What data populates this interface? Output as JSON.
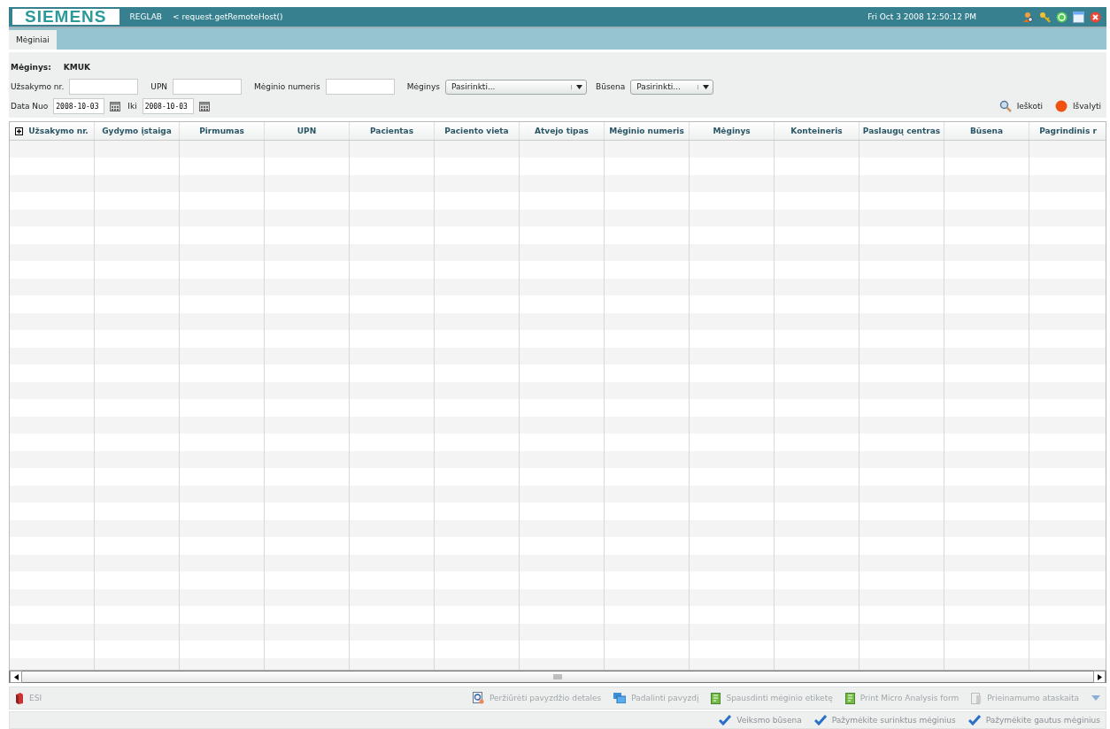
{
  "header": {
    "logo": "SIEMENS",
    "app": "REGLAB",
    "host": "< request.getRemoteHost()",
    "datetime": "Fri Oct 3 2008 12:50:12 PM"
  },
  "tabs": [
    {
      "label": "Mėginiai",
      "selected": true
    }
  ],
  "filter": {
    "title_label": "Mėginys:",
    "title_value": "KMUK",
    "row_1": [
      {
        "kind": "text",
        "label": "Užsakymo nr."
      },
      {
        "kind": "text",
        "label": "UPN"
      },
      {
        "kind": "text",
        "label": "Mėginio numeris"
      },
      {
        "kind": "select",
        "label": "Mėginys",
        "value": "Pasirinkti..."
      },
      {
        "kind": "select",
        "label": "Būsena",
        "value": "Pasirinkti..."
      }
    ],
    "row_2": [
      {
        "kind": "date",
        "label": "Data Nuo",
        "value": "2008-10-03"
      },
      {
        "kind": "date",
        "label": "Iki",
        "value": "2008-10-03"
      }
    ],
    "actions": [
      {
        "kind": "search",
        "label": "Ieškoti"
      },
      {
        "kind": "clear",
        "label": "Išvalyti"
      }
    ]
  },
  "table": {
    "columns": [
      "Užsakymo nr.",
      "Gydymo įstaiga",
      "Pirmumas",
      "UPN",
      "Pacientas",
      "Paciento vieta",
      "Atvejo tipas",
      "Mėginio numeris",
      "Mėginys",
      "Konteineris",
      "Paslaugų centras",
      "Būsena",
      "Pagrindinis r"
    ]
  },
  "toolbar": {
    "left": [
      {
        "kind": "book",
        "label": "ESI",
        "disabled": true
      }
    ],
    "right": [
      {
        "kind": "view",
        "label": "Peržiūrėti pavyzdžio detales",
        "disabled": true
      },
      {
        "kind": "split",
        "label": "Padalinti pavyzdį",
        "disabled": true
      },
      {
        "kind": "print",
        "label": "Spausdinti mėginio etiketę",
        "disabled": true
      },
      {
        "kind": "print",
        "label": "Print Micro Analysis form",
        "disabled": true
      },
      {
        "kind": "report",
        "label": "Prieinamumo ataskaita",
        "disabled": true
      }
    ]
  },
  "status_actions": [
    "Veiksmo būsena",
    "Pažymėkite surinktus mėginius",
    "Pažymėkite gautus mėginius"
  ]
}
